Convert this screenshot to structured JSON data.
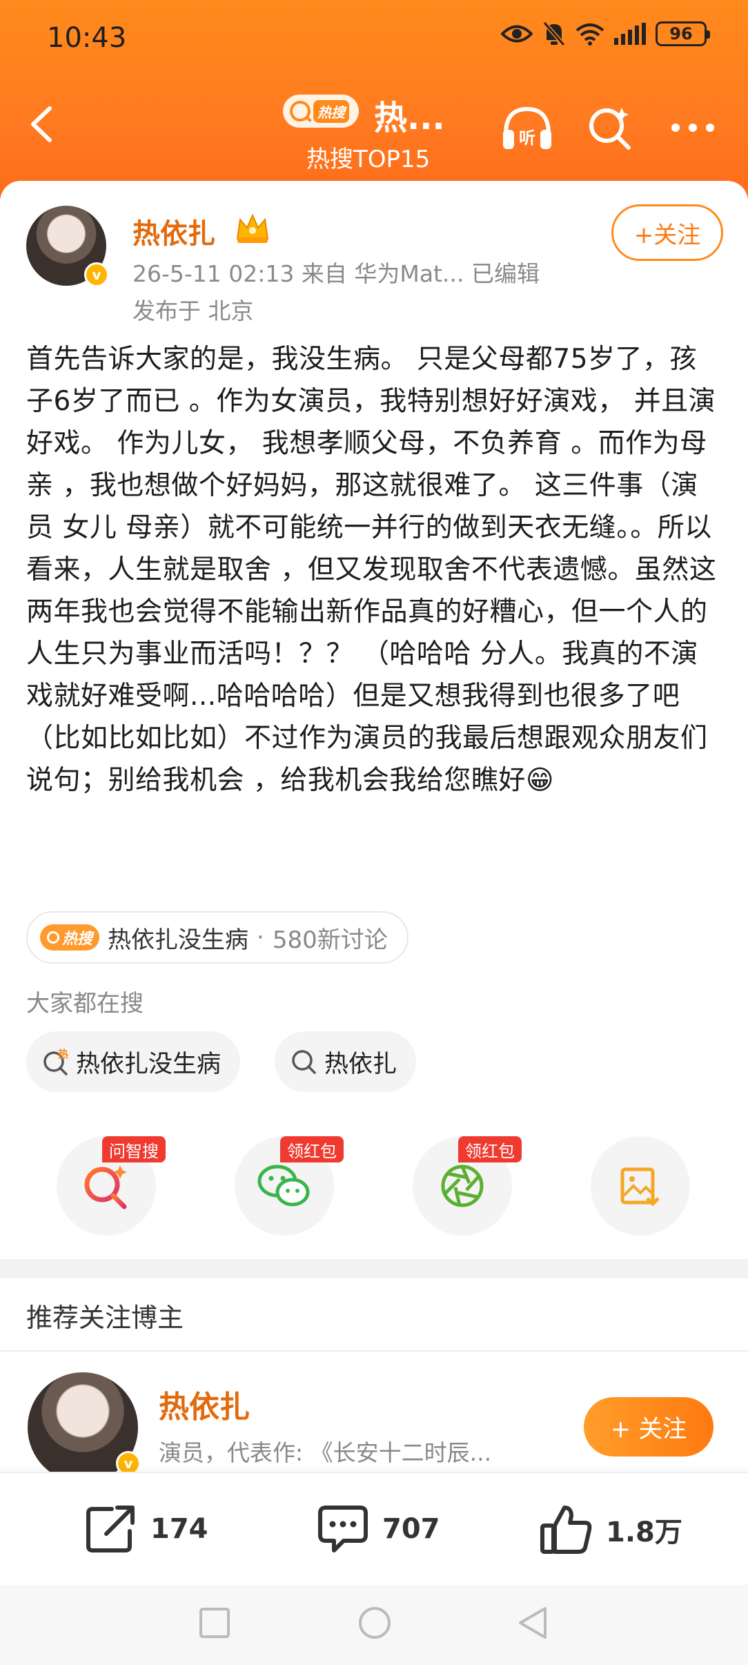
{
  "status_bar": {
    "time": "10:43",
    "battery": "96"
  },
  "nav": {
    "badge_text": "热搜",
    "title": "热...",
    "subtitle": "热搜TOP15"
  },
  "post": {
    "author": "热依扎",
    "meta_line": "26-5-11 02:13   来自 华为Mat...   已编辑",
    "location": "发布于 北京",
    "follow_label": "+关注",
    "content": "首先告诉大家的是，我没生病。 只是父母都75岁了，孩子6岁了而已 。作为女演员，我特别想好好演戏， 并且演好戏。 作为儿女， 我想孝顺父母，不负养育 。而作为母亲 ，我也想做个好妈妈，那这就很难了。 这三件事（演员 女儿 母亲）就不可能统一并行的做到天衣无缝。。所以看来，人生就是取舍 ，但又发现取舍不代表遗憾。虽然这两年我也会觉得不能输出新作品真的好糟心，但一个人的人生只为事业而活吗！？？ （哈哈哈 分人。我真的不演戏就好难受啊...哈哈哈哈）但是又想我得到也很多了吧（比如比如比如）不过作为演员的我最后想跟观众朋友们说句；别给我机会 ，给我机会我给您瞧好😁"
  },
  "topic": {
    "badge": "热搜",
    "name": "热依扎没生病",
    "separator": "·",
    "count": "580新讨论"
  },
  "search_section": {
    "label": "大家都在搜",
    "chips": [
      {
        "text": "热依扎没生病",
        "icon": "hot-search-icon"
      },
      {
        "text": "热依扎",
        "icon": "search-icon"
      }
    ]
  },
  "actions": [
    {
      "tag": "问智搜",
      "icon": "ai-search-icon"
    },
    {
      "tag": "领红包",
      "icon": "wechat-icon"
    },
    {
      "tag": "领红包",
      "icon": "moments-icon"
    },
    {
      "tag": "",
      "icon": "save-image-icon"
    }
  ],
  "recommend": {
    "title": "推荐关注博主",
    "name": "热依扎",
    "desc": "演员，代表作: 《长安十二时辰...",
    "follow_label": "+ 关注"
  },
  "bottom_bar": {
    "shares": "174",
    "comments": "707",
    "likes": "1.8万"
  },
  "colors": {
    "accent": "#ff8a1c",
    "name_orange": "#e36a0c",
    "tag_red": "#f03a30"
  }
}
